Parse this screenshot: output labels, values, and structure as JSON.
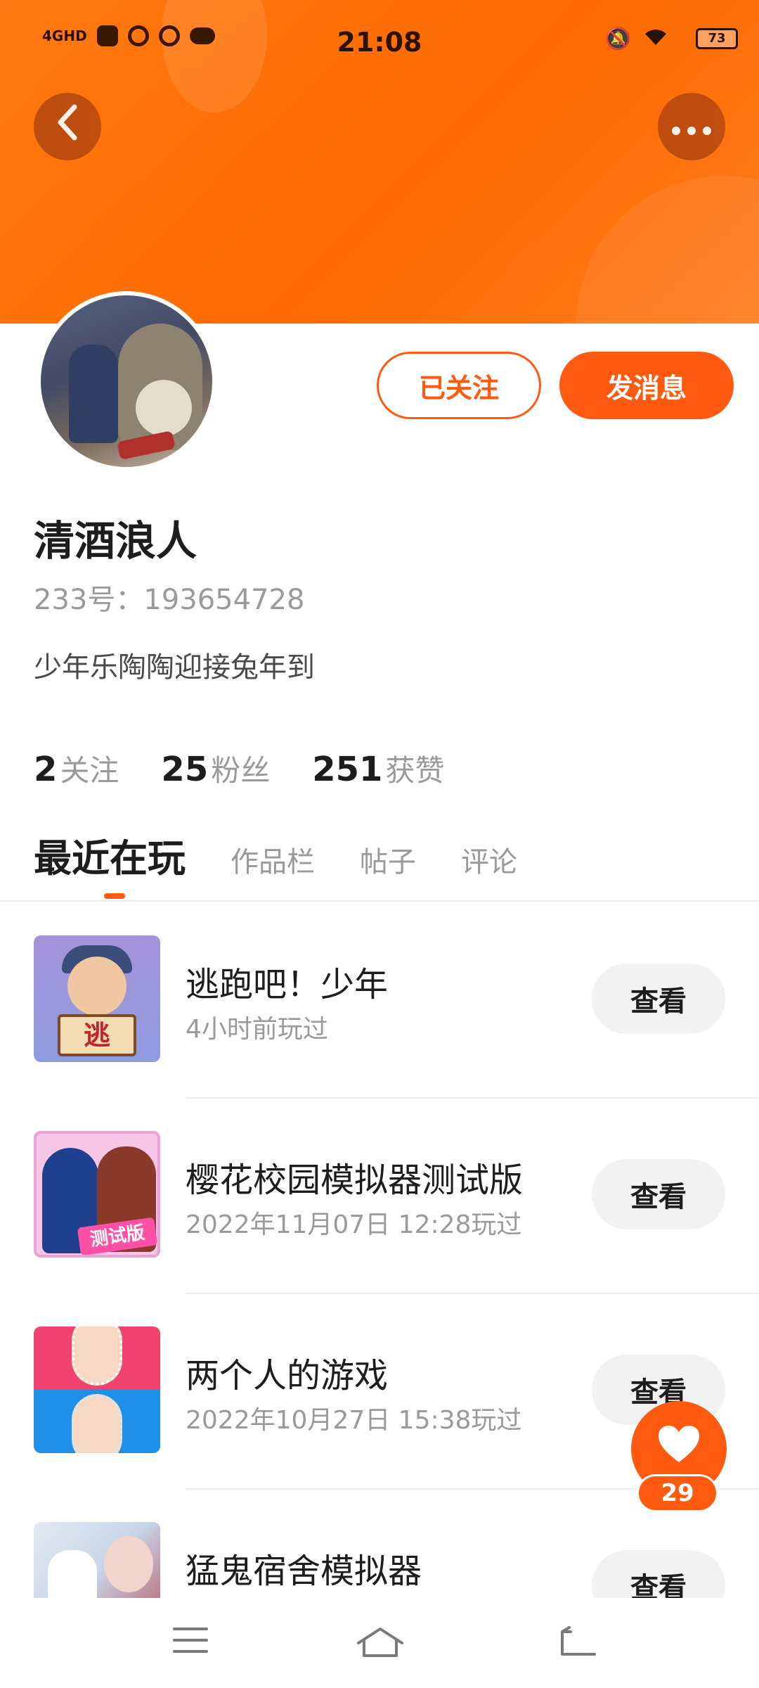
{
  "status_bar": {
    "network": "4GHD",
    "time": "21:08",
    "battery": "73"
  },
  "profile": {
    "username": "清酒浪人",
    "id_label": "233号：193654728",
    "bio": "少年乐陶陶迎接兔年到",
    "follow_label": "已关注",
    "message_label": "发消息"
  },
  "stats": [
    {
      "value": "2",
      "label": "关注"
    },
    {
      "value": "25",
      "label": "粉丝"
    },
    {
      "value": "251",
      "label": "获赞"
    }
  ],
  "tabs": [
    {
      "label": "最近在玩",
      "active": true
    },
    {
      "label": "作品栏"
    },
    {
      "label": "帖子"
    },
    {
      "label": "评论"
    }
  ],
  "games": [
    {
      "title": "逃跑吧！少年",
      "played": "4小时前玩过",
      "action": "查看",
      "thumb_text": "逃"
    },
    {
      "title": "樱花校园模拟器测试版",
      "played": "2022年11月07日 12:28玩过",
      "action": "查看",
      "thumb_text": "测试版"
    },
    {
      "title": "两个人的游戏",
      "played": "2022年10月27日 15:38玩过",
      "action": "查看"
    },
    {
      "title": "猛鬼宿舍模拟器",
      "played": "",
      "action": "查看"
    }
  ],
  "like": {
    "count": "29"
  },
  "colors": {
    "accent": "#ff5a10",
    "banner": "#ff7a12"
  },
  "icons": {
    "back": "chevron-left-icon",
    "more": "more-dots-icon",
    "like": "heart-icon",
    "nav": [
      "menu-icon",
      "home-icon",
      "back-icon"
    ]
  }
}
